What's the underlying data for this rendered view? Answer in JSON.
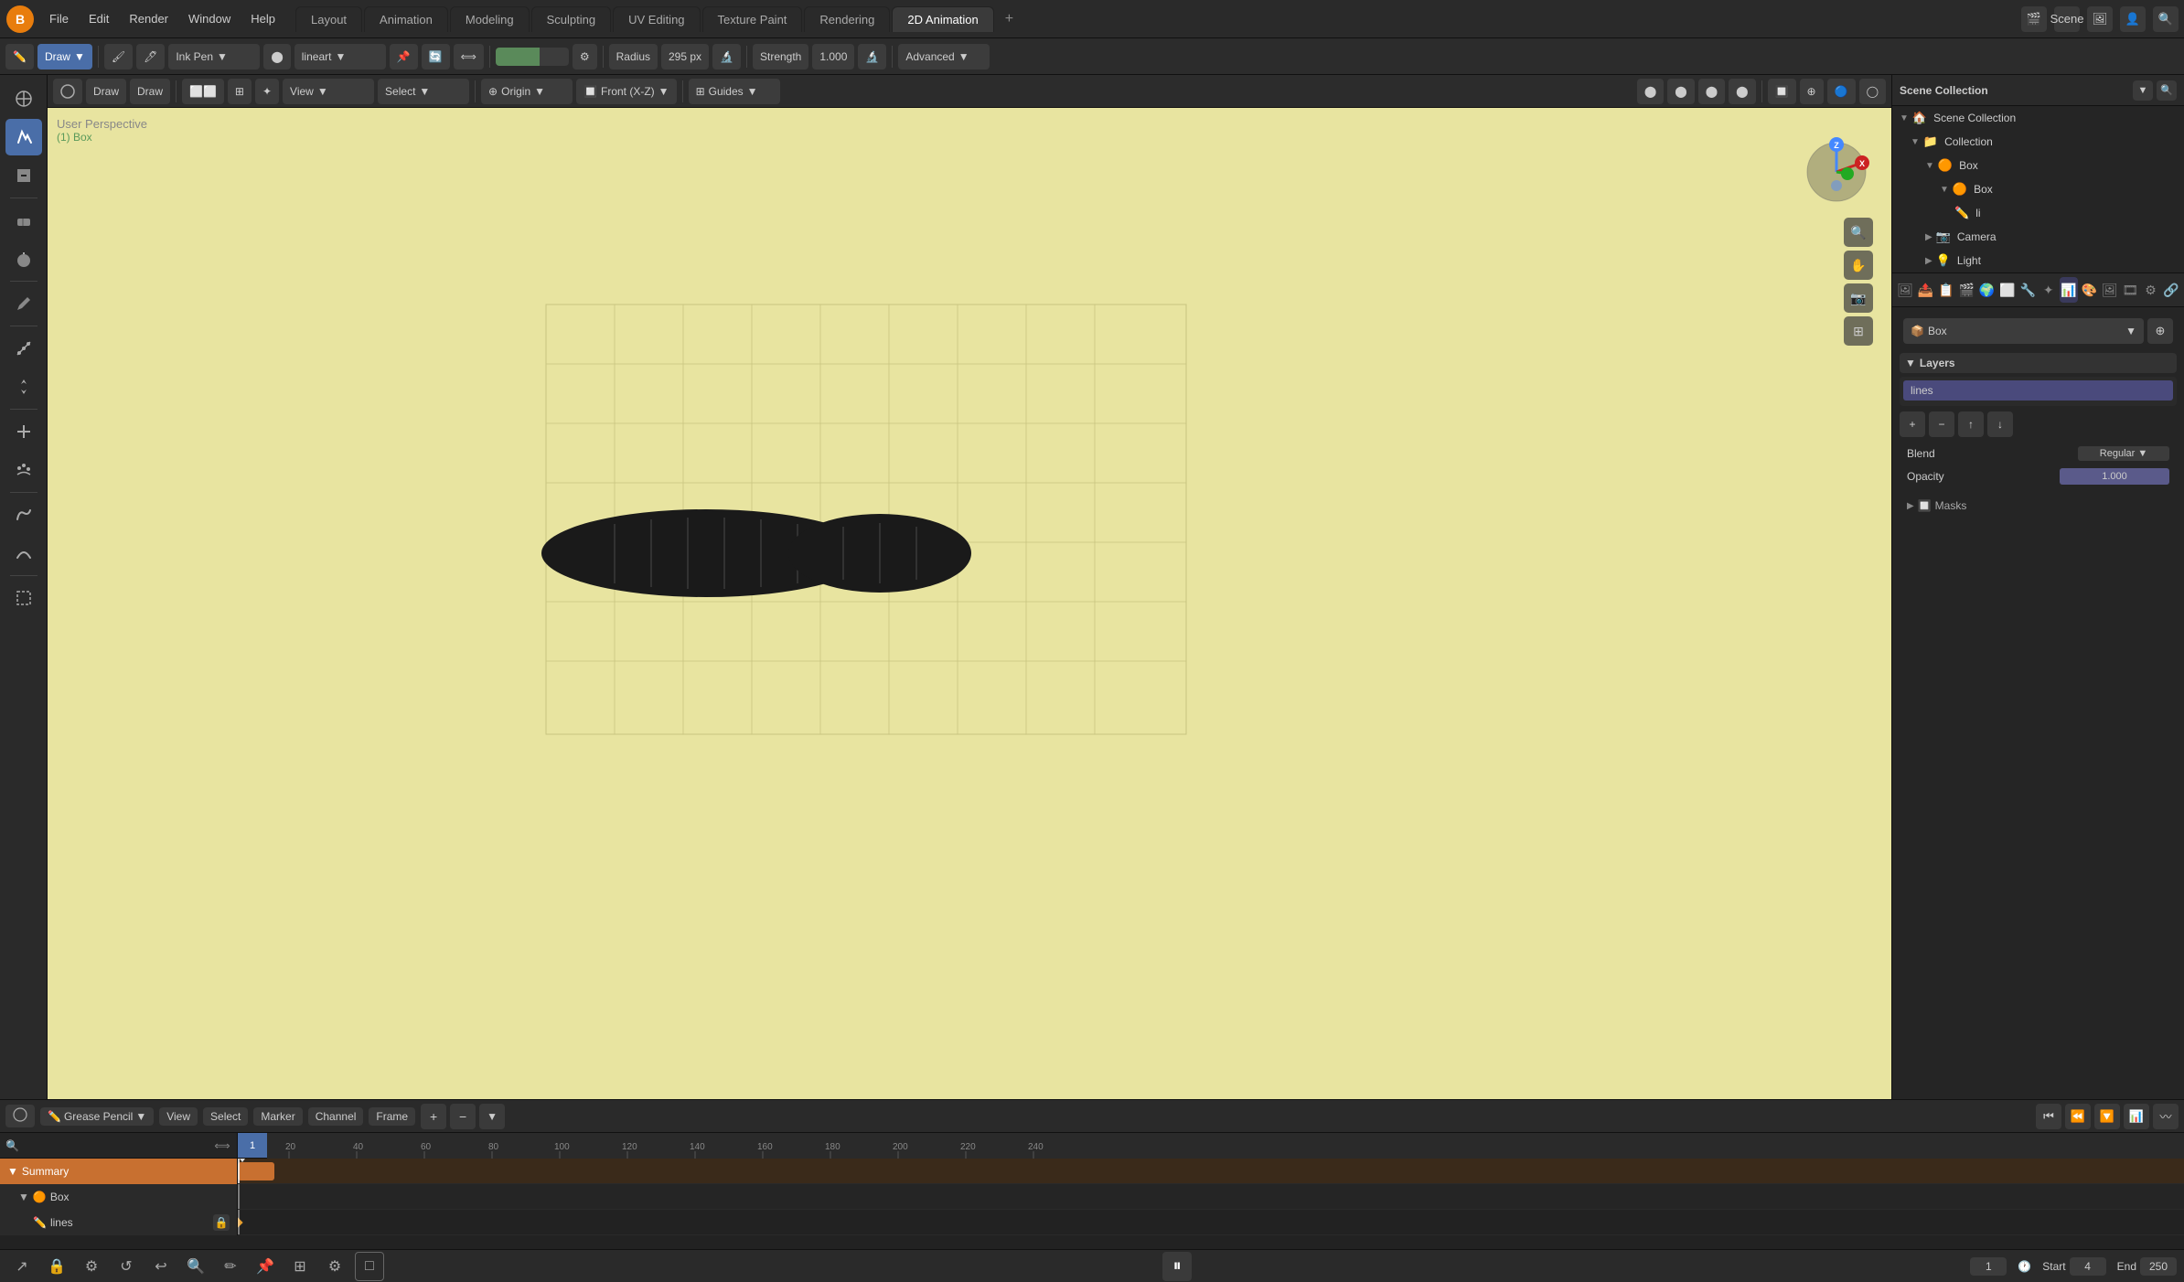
{
  "app": {
    "title": "Blender"
  },
  "menu": {
    "items": [
      "File",
      "Edit",
      "Render",
      "Window",
      "Help"
    ]
  },
  "workspaces": [
    {
      "label": "Layout",
      "active": false
    },
    {
      "label": "Animation",
      "active": false
    },
    {
      "label": "Modeling",
      "active": false
    },
    {
      "label": "Sculpting",
      "active": false
    },
    {
      "label": "UV Editing",
      "active": false
    },
    {
      "label": "Texture Paint",
      "active": false
    },
    {
      "label": "Rendering",
      "active": false
    },
    {
      "label": "2D Animation",
      "active": true
    }
  ],
  "toolbar": {
    "mode": "Draw",
    "tool": "Ink Pen",
    "brush_preset": "lineart",
    "radius_label": "Radius",
    "radius_value": "295 px",
    "strength_label": "Strength",
    "strength_value": "1.000",
    "advanced_label": "Advanced"
  },
  "viewport": {
    "info_line1": "User Perspective",
    "info_line2": "(1) Box",
    "view_mode": "Front (X-Z)",
    "origin": "Origin",
    "snapping": "Guides"
  },
  "outliner": {
    "title": "Scene Collection",
    "items": [
      {
        "label": "Collection",
        "level": 0,
        "icon": "📁",
        "expanded": true
      },
      {
        "label": "Box",
        "level": 1,
        "icon": "📦",
        "expanded": true
      },
      {
        "label": "Box",
        "level": 2,
        "icon": "📦",
        "expanded": true
      },
      {
        "label": "li",
        "level": 3,
        "icon": "✏️"
      },
      {
        "label": "Camera",
        "level": 1,
        "icon": "📷"
      },
      {
        "label": "Light",
        "level": 1,
        "icon": "💡"
      }
    ]
  },
  "properties": {
    "active_tab": "object_data",
    "object_name": "Box",
    "layers_title": "Layers",
    "layers": [
      {
        "label": "lines",
        "active": true
      }
    ],
    "blend_label": "Blend",
    "opacity_label": "Opacity",
    "masks_label": "Masks"
  },
  "timeline": {
    "type_label": "Grease Pencil",
    "view_label": "View",
    "select_label": "Select",
    "marker_label": "Marker",
    "channel_label": "Channel",
    "frame_label": "Frame",
    "current_frame": "1",
    "start_label": "Start",
    "start_value": "4",
    "end_label": "End",
    "end_value": "250",
    "frame_display": "1",
    "ruler_marks": [
      20,
      40,
      60,
      80,
      100,
      120,
      140,
      160,
      180,
      200,
      220,
      240
    ],
    "tracks": [
      {
        "label": "Summary",
        "type": "summary"
      },
      {
        "label": "Box",
        "type": "box"
      },
      {
        "label": "lines",
        "type": "lines"
      }
    ]
  }
}
